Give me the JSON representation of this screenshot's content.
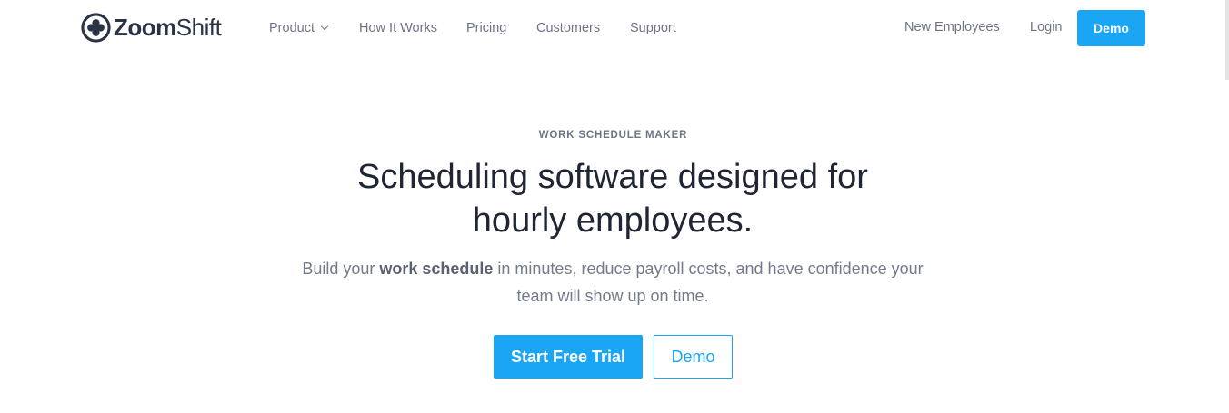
{
  "brand": {
    "name_bold": "Zoom",
    "name_regular": "Shift",
    "logo_icon": "four-leaf-clover-circle-icon",
    "color": "#2b3346"
  },
  "nav": {
    "items": [
      {
        "label": "Product",
        "has_dropdown": true
      },
      {
        "label": "How It Works"
      },
      {
        "label": "Pricing"
      },
      {
        "label": "Customers"
      },
      {
        "label": "Support"
      }
    ],
    "right": {
      "new_employees": "New Employees",
      "login": "Login",
      "demo": "Demo"
    }
  },
  "hero": {
    "eyebrow": "WORK SCHEDULE MAKER",
    "headline_line1": "Scheduling software designed for",
    "headline_line2": "hourly employees.",
    "sub_part1": "Build your ",
    "sub_bold": "work schedule",
    "sub_part2": " in minutes, reduce payroll costs, and have confidence your team will show up on time.",
    "primary_cta": "Start Free Trial",
    "secondary_cta": "Demo"
  },
  "colors": {
    "accent": "#1aa6f5",
    "heading": "#1f2532",
    "muted": "#6d7585"
  }
}
